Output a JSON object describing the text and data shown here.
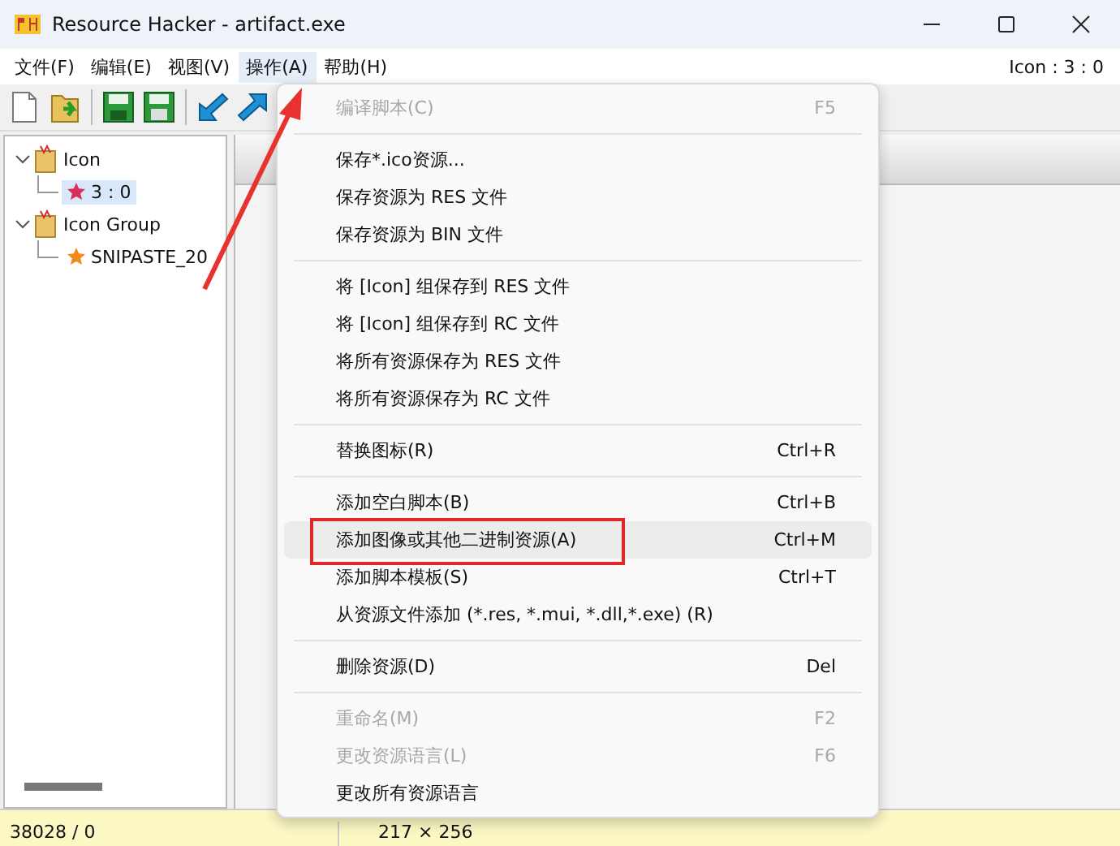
{
  "window": {
    "title": "Resource Hacker - artifact.exe"
  },
  "menubar": [
    {
      "label": "文件(F)",
      "selected": false
    },
    {
      "label": "编辑(E)",
      "selected": false
    },
    {
      "label": "视图(V)",
      "selected": false
    },
    {
      "label": "操作(A)",
      "selected": true
    },
    {
      "label": "帮助(H)",
      "selected": false
    }
  ],
  "menubar_status": "Icon : 3 : 0",
  "toolbar": [
    {
      "kind": "new"
    },
    {
      "kind": "open"
    },
    {
      "kind": "save"
    },
    {
      "kind": "saveas"
    },
    {
      "kind": "back"
    },
    {
      "kind": "forward"
    }
  ],
  "tree": [
    {
      "label": "Icon",
      "expanded": true,
      "children": [
        {
          "label": "3 : 0",
          "selected": true,
          "color": "#d8305a"
        }
      ]
    },
    {
      "label": "Icon Group",
      "expanded": true,
      "children": [
        {
          "label": "SNIPASTE_20",
          "selected": false,
          "color": "#f08a1c"
        }
      ]
    }
  ],
  "menu": [
    {
      "kind": "item",
      "label": "编译脚本(C)",
      "shortcut": "F5",
      "disabled": true,
      "highlighted": false,
      "outlined": false
    },
    {
      "kind": "separator"
    },
    {
      "kind": "item",
      "label": "保存*.ico资源...",
      "disabled": false,
      "highlighted": false,
      "outlined": false
    },
    {
      "kind": "item",
      "label": "保存资源为 RES 文件",
      "disabled": false,
      "highlighted": false,
      "outlined": false
    },
    {
      "kind": "item",
      "label": "保存资源为 BIN 文件",
      "disabled": false,
      "highlighted": false,
      "outlined": false
    },
    {
      "kind": "separator"
    },
    {
      "kind": "item",
      "label": "将 [Icon] 组保存到 RES 文件",
      "disabled": false,
      "highlighted": false,
      "outlined": false
    },
    {
      "kind": "item",
      "label": "将 [Icon] 组保存到 RC 文件",
      "disabled": false,
      "highlighted": false,
      "outlined": false
    },
    {
      "kind": "item",
      "label": "将所有资源保存为 RES 文件",
      "disabled": false,
      "highlighted": false,
      "outlined": false
    },
    {
      "kind": "item",
      "label": "将所有资源保存为 RC 文件",
      "disabled": false,
      "highlighted": false,
      "outlined": false
    },
    {
      "kind": "separator"
    },
    {
      "kind": "item",
      "label": "替换图标(R)",
      "shortcut": "Ctrl+R",
      "disabled": false,
      "highlighted": false,
      "outlined": false
    },
    {
      "kind": "separator"
    },
    {
      "kind": "item",
      "label": "添加空白脚本(B)",
      "shortcut": "Ctrl+B",
      "disabled": false,
      "highlighted": false,
      "outlined": false
    },
    {
      "kind": "item",
      "label": "添加图像或其他二进制资源(A)",
      "shortcut": "Ctrl+M",
      "disabled": false,
      "highlighted": true,
      "outlined": true
    },
    {
      "kind": "item",
      "label": "添加脚本模板(S)",
      "shortcut": "Ctrl+T",
      "disabled": false,
      "highlighted": false,
      "outlined": false
    },
    {
      "kind": "item",
      "label": "从资源文件添加 (*.res, *.mui, *.dll,*.exe) (R)",
      "disabled": false,
      "highlighted": false,
      "outlined": false
    },
    {
      "kind": "separator"
    },
    {
      "kind": "item",
      "label": "删除资源(D)",
      "shortcut": "Del",
      "disabled": false,
      "highlighted": false,
      "outlined": false
    },
    {
      "kind": "separator"
    },
    {
      "kind": "item",
      "label": "重命名(M)",
      "shortcut": "F2",
      "disabled": true,
      "highlighted": false,
      "outlined": false
    },
    {
      "kind": "item",
      "label": "更改资源语言(L)",
      "shortcut": "F6",
      "disabled": true,
      "highlighted": false,
      "outlined": false
    },
    {
      "kind": "item",
      "label": "更改所有资源语言",
      "disabled": false,
      "highlighted": false,
      "outlined": false
    }
  ],
  "status_bar": [
    "38028 / 0",
    "217 × 256"
  ]
}
